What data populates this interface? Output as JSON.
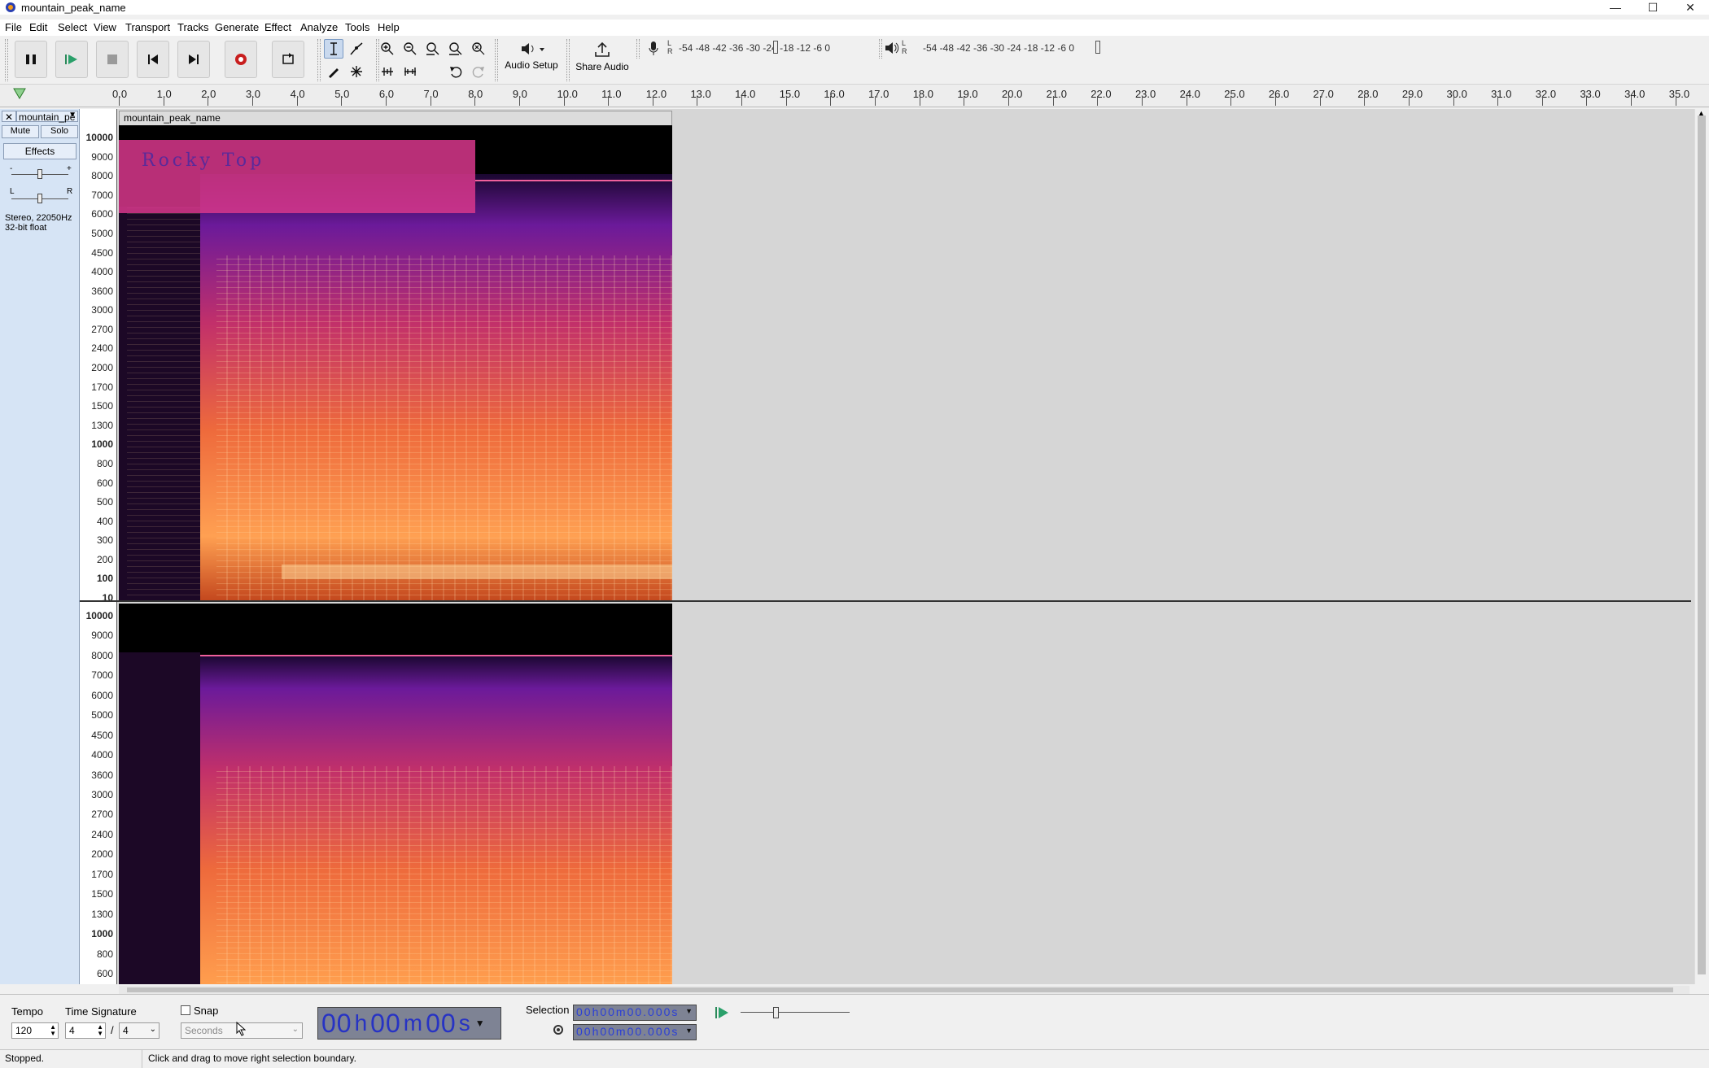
{
  "window": {
    "title": "mountain_peak_name",
    "minimize": "—",
    "maximize": "☐",
    "close": "✕"
  },
  "menu": [
    "File",
    "Edit",
    "Select",
    "View",
    "Transport",
    "Tracks",
    "Generate",
    "Effect",
    "Analyze",
    "Tools",
    "Help"
  ],
  "toolbar": {
    "audio_setup_label": "Audio Setup",
    "share_audio_label": "Share Audio",
    "record_meter_scale": "-54  -48  -42  -36  -30  -24  -18  -12  -6  0",
    "play_meter_scale": "-54  -48  -42  -36  -30  -24  -18  -12  -6  0",
    "meter_lr": "L\nR"
  },
  "ruler": {
    "ticks": [
      "0.0",
      "1.0",
      "2.0",
      "3.0",
      "4.0",
      "5.0",
      "6.0",
      "7.0",
      "8.0",
      "9.0",
      "10.0",
      "11.0",
      "12.0",
      "13.0",
      "14.0",
      "15.0",
      "16.0",
      "17.0",
      "18.0",
      "19.0",
      "20.0",
      "21.0",
      "22.0",
      "23.0",
      "24.0",
      "25.0",
      "26.0",
      "27.0",
      "28.0",
      "29.0",
      "30.0",
      "31.0",
      "32.0",
      "33.0",
      "34.0",
      "35.0"
    ]
  },
  "track": {
    "name": "mountain_pe",
    "clip_name": "mountain_peak_name",
    "mute_label": "Mute",
    "solo_label": "Solo",
    "effects_label": "Effects",
    "gain_minus": "-",
    "gain_plus": "+",
    "pan_left": "L",
    "pan_right": "R",
    "info_line1": "Stereo, 22050Hz",
    "info_line2": "32-bit float",
    "spectrogram_text": "Rocky Top"
  },
  "freq_scale_top": [
    "10000",
    "9000",
    "8000",
    "7000",
    "6000",
    "5000",
    "4500",
    "4000",
    "3600",
    "3000",
    "2700",
    "2400",
    "2000",
    "1700",
    "1500",
    "1300",
    "1000",
    "800",
    "600",
    "500",
    "400",
    "300",
    "200",
    "100",
    "10"
  ],
  "freq_scale_bottom": [
    "10000",
    "9000",
    "8000",
    "7000",
    "6000",
    "5000",
    "4500",
    "4000",
    "3600",
    "3000",
    "2700",
    "2400",
    "2000",
    "1700",
    "1500",
    "1300",
    "1000",
    "800",
    "600"
  ],
  "bottom": {
    "tempo_label": "Tempo",
    "tempo_value": "120",
    "time_sig_label": "Time Signature",
    "time_sig_num": "4",
    "time_sig_slash": "/",
    "time_sig_den": "4",
    "snap_label": "Snap",
    "snap_unit": "Seconds",
    "time_h": "00",
    "time_m": "00",
    "time_s": "00",
    "unit_h": "h",
    "unit_m": "m",
    "unit_s": "s",
    "selection_label": "Selection",
    "sel_start": "00h00m00.000s",
    "sel_end": "00h00m00.000s"
  },
  "status": {
    "state": "Stopped.",
    "hint": "Click and drag to move right selection boundary."
  },
  "colors": {
    "selection_blue": "#d6e4f5",
    "time_text": "#2733c4",
    "spectro_hot": "#ffb060",
    "spectro_mid": "#c2306a",
    "spectro_cold": "#2a0b4a"
  }
}
